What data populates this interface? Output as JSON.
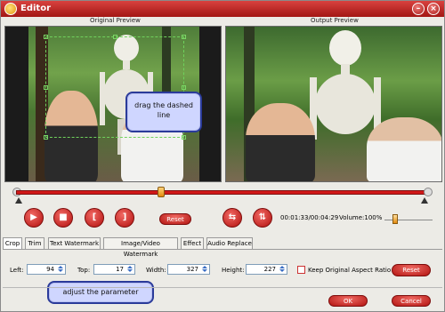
{
  "window": {
    "title": "Editor"
  },
  "previews": {
    "original_label": "Original Preview",
    "output_label": "Output Preview"
  },
  "callouts": {
    "drag": "drag the dashed line",
    "adjust": "adjust the parameter"
  },
  "playback": {
    "reset_label": "Reset",
    "time": "00:01:33/00:04:29",
    "volume_label": "Volume:100%",
    "volume_level": 0.25,
    "position_fraction": 0.35
  },
  "tabs": [
    {
      "label": "Crop",
      "active": true
    },
    {
      "label": "Trim",
      "active": false
    },
    {
      "label": "Text Watermark",
      "active": false
    },
    {
      "label": "Image/Video Watermark",
      "active": false
    },
    {
      "label": "Effect",
      "active": false
    },
    {
      "label": "Audio Replace",
      "active": false
    }
  ],
  "crop": {
    "left_label": "Left:",
    "left_value": "94",
    "top_label": "Top:",
    "top_value": "17",
    "width_label": "Width:",
    "width_value": "327",
    "height_label": "Height:",
    "height_value": "227",
    "keep_ratio_label": "Keep Original Aspect Ratio",
    "keep_ratio_checked": false,
    "reset_label": "Reset"
  },
  "footer": {
    "ok_label": "OK",
    "cancel_label": "Cancel"
  },
  "colors": {
    "accent_red": "#c8201d",
    "crop_line": "#6fd25c",
    "callout_fill": "#cfd6ff",
    "callout_border": "#2b3b9a"
  }
}
